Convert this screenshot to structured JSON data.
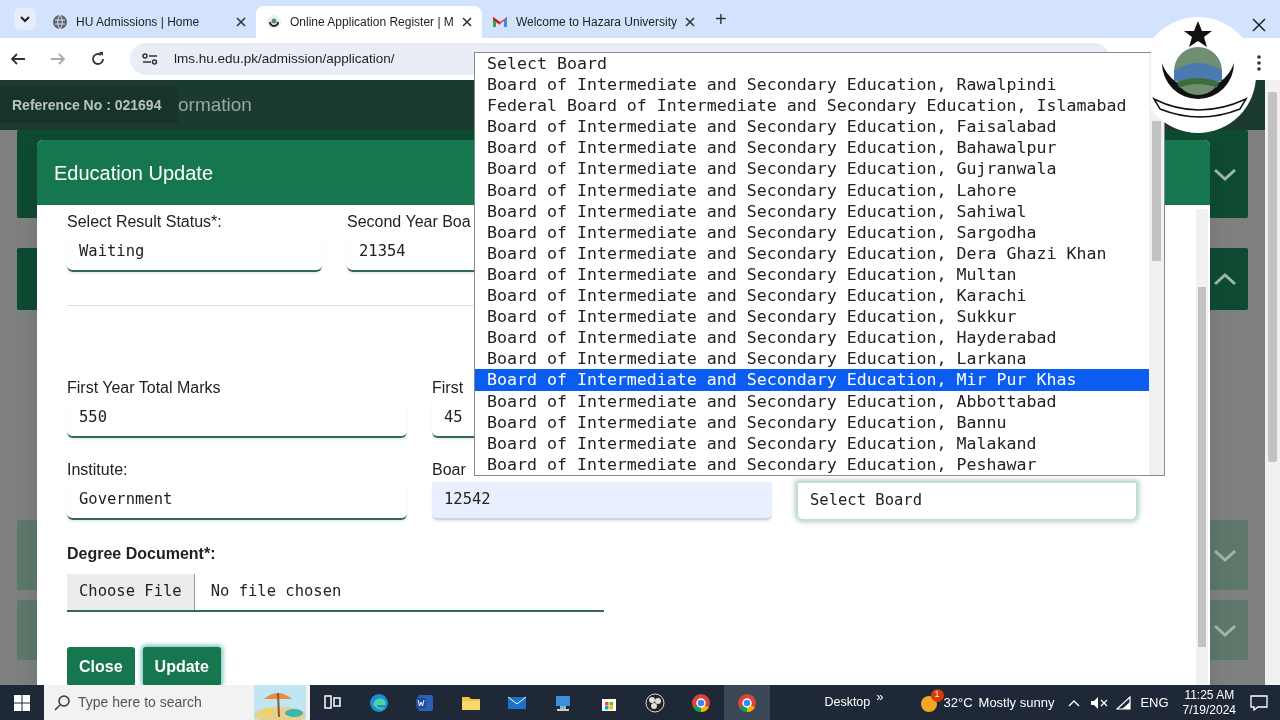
{
  "browser": {
    "tabs": [
      {
        "title": "HU Admissions | Home",
        "kind": "globe",
        "selected": false
      },
      {
        "title": "Online Application Register | M",
        "kind": "emblem",
        "selected": true
      },
      {
        "title": "Welcome to Hazara University",
        "kind": "mail",
        "selected": false
      }
    ],
    "new_tab": "+",
    "address": "lms.hu.edu.pk/admission/application/"
  },
  "page": {
    "reference": "Reference No : 021694",
    "heading": "ormation",
    "panels": [
      {
        "expanded": false
      },
      {
        "expanded": true
      },
      {
        "expanded": false
      },
      {
        "expanded": false
      }
    ]
  },
  "modal": {
    "title": "Education Update",
    "rows": [
      {
        "fields": [
          {
            "label": "Select Result Status*:",
            "value": "Waiting",
            "autofilled": false,
            "focused": false
          },
          {
            "label": "Second Year Boa",
            "value": "21354",
            "autofilled": false,
            "focused": false
          }
        ]
      },
      {
        "fields": [
          {
            "label": "First Year Total Marks",
            "value": "550",
            "autofilled": false,
            "focused": false
          },
          {
            "label": "First",
            "value": "45",
            "autofilled": false,
            "focused": false
          }
        ]
      },
      {
        "fields": [
          {
            "label": "Institute:",
            "value": "Government",
            "autofilled": false,
            "focused": false
          },
          {
            "label": "Boar",
            "value": "12542",
            "autofilled": true,
            "focused": false
          },
          {
            "value": "Select Board",
            "autofilled": false,
            "focused": true
          }
        ]
      }
    ],
    "document": {
      "label": "Degree Document*:",
      "button": "Choose File",
      "status": "No file chosen"
    },
    "buttons": [
      {
        "label": "Close",
        "focused": false
      },
      {
        "label": "Update",
        "focused": true
      }
    ]
  },
  "dropdown": {
    "options": [
      {
        "label": "Select Board",
        "selected": false
      },
      {
        "label": "Board of Intermediate and Secondary Education, Rawalpindi",
        "selected": false
      },
      {
        "label": "Federal Board of Intermediate and Secondary Education, Islamabad",
        "selected": false
      },
      {
        "label": "Board of Intermediate and Secondary Education, Faisalabad",
        "selected": false
      },
      {
        "label": "Board of Intermediate and Secondary Education, Bahawalpur",
        "selected": false
      },
      {
        "label": "Board of Intermediate and Secondary Education, Gujranwala",
        "selected": false
      },
      {
        "label": "Board of Intermediate and Secondary Education, Lahore",
        "selected": false
      },
      {
        "label": "Board of Intermediate and Secondary Education, Sahiwal",
        "selected": false
      },
      {
        "label": "Board of Intermediate and Secondary Education, Sargodha",
        "selected": false
      },
      {
        "label": "Board of Intermediate and Secondary Education, Dera Ghazi Khan",
        "selected": false
      },
      {
        "label": "Board of Intermediate and Secondary Education, Multan",
        "selected": false
      },
      {
        "label": "Board of Intermediate and Secondary Education, Karachi",
        "selected": false
      },
      {
        "label": "Board of Intermediate and Secondary Education, Sukkur",
        "selected": false
      },
      {
        "label": "Board of Intermediate and Secondary Education, Hayderabad",
        "selected": false
      },
      {
        "label": "Board of Intermediate and Secondary Education, Larkana",
        "selected": false
      },
      {
        "label": "Board of Intermediate and Secondary Education, Mir Pur Khas",
        "selected": true
      },
      {
        "label": "Board of Intermediate and Secondary Education, Abbottabad",
        "selected": false
      },
      {
        "label": "Board of Intermediate and Secondary Education, Bannu",
        "selected": false
      },
      {
        "label": "Board of Intermediate and Secondary Education, Malakand",
        "selected": false
      },
      {
        "label": "Board of Intermediate and Secondary Education, Peshawar",
        "selected": false
      }
    ]
  },
  "taskbar": {
    "search_placeholder": "Type here to search",
    "apps": [
      {
        "kind": "taskview",
        "active": false
      },
      {
        "kind": "edge",
        "active": false
      },
      {
        "kind": "word",
        "active": false
      },
      {
        "kind": "folder",
        "active": false
      },
      {
        "kind": "mail",
        "active": false
      },
      {
        "kind": "remote",
        "active": false
      },
      {
        "kind": "store",
        "active": false
      },
      {
        "kind": "obs",
        "active": false
      },
      {
        "kind": "chrome",
        "active": false
      },
      {
        "kind": "chrome",
        "active": true
      }
    ],
    "desktop": "Desktop",
    "overflow": "»",
    "weather_badge": "1",
    "temperature": "32°C",
    "weather": "Mostly sunny",
    "language": "ENG",
    "time": "11:25 AM",
    "date": "7/19/2024"
  }
}
